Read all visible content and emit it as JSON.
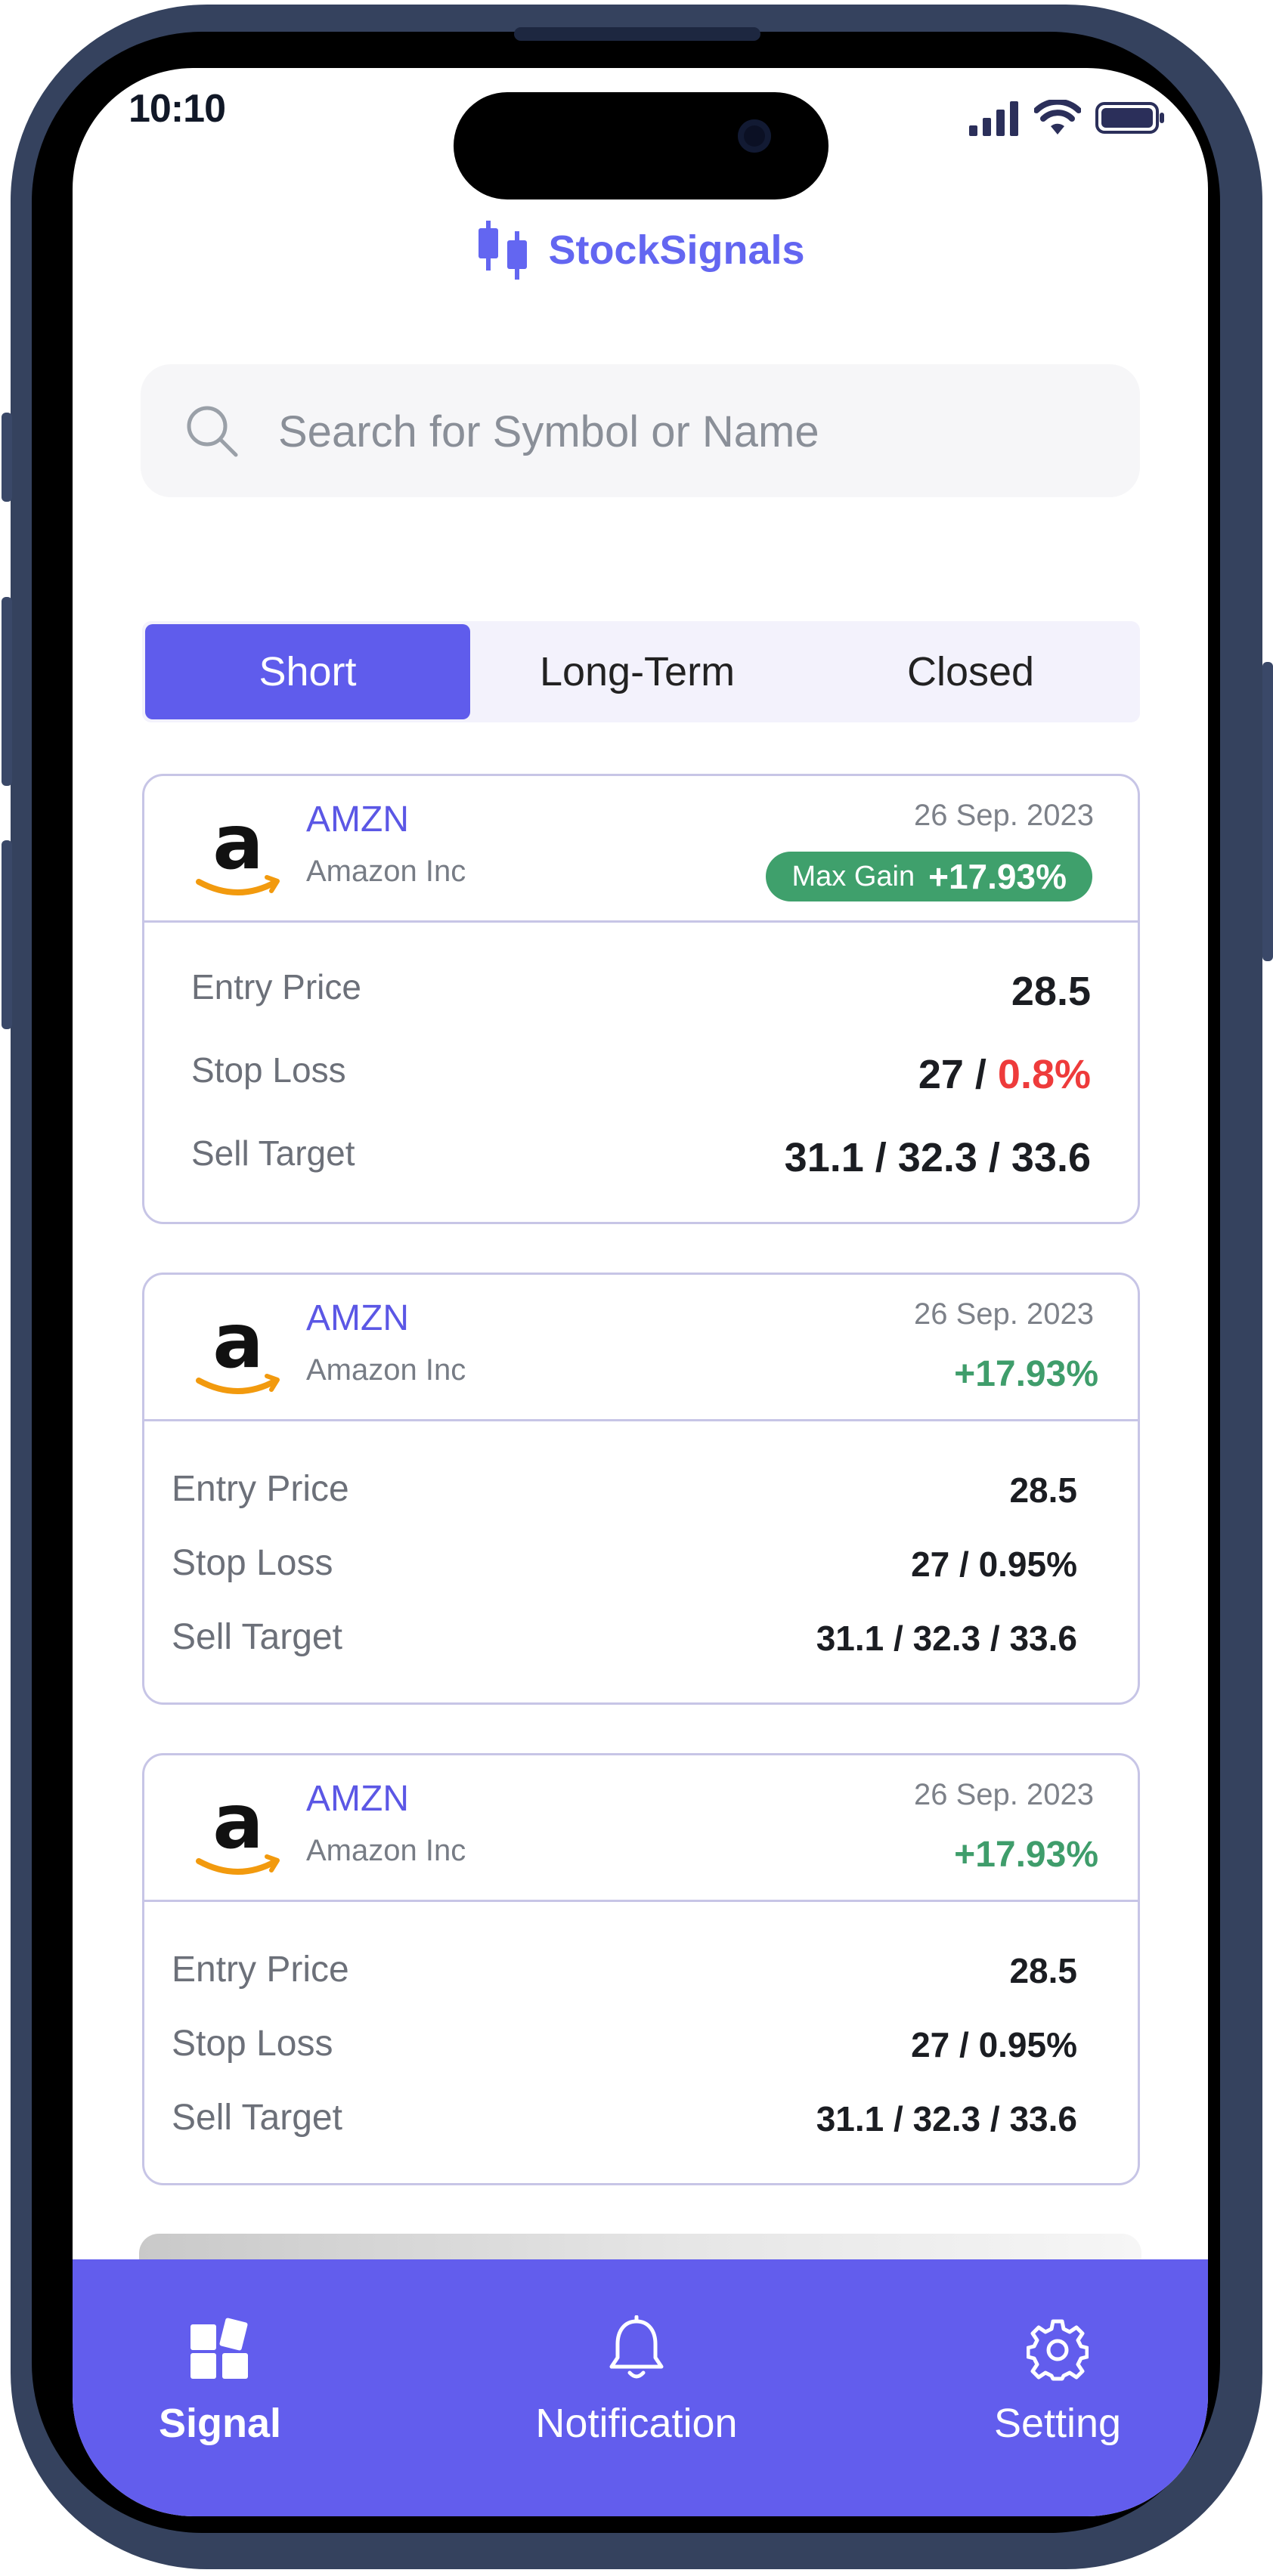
{
  "status_bar": {
    "time": "10:10"
  },
  "app": {
    "name": "StockSignals"
  },
  "search": {
    "placeholder": "Search for Symbol or Name"
  },
  "tabs": [
    {
      "label": "Short",
      "active": true
    },
    {
      "label": "Long-Term",
      "active": false
    },
    {
      "label": "Closed",
      "active": false
    }
  ],
  "cards": [
    {
      "symbol": "AMZN",
      "company": "Amazon Inc",
      "date": "26 Sep. 2023",
      "badge_label": "Max Gain",
      "gain": "+17.93%",
      "rows": {
        "entry_label": "Entry Price",
        "entry_value": "28.5",
        "stop_label": "Stop Loss",
        "stop_value": "27 / ",
        "stop_pct": "0.8%",
        "target_label": "Sell Target",
        "target_value": "31.1 / 32.3 / 33.6"
      }
    },
    {
      "symbol": "AMZN",
      "company": "Amazon Inc",
      "date": "26 Sep. 2023",
      "gain": "+17.93%",
      "rows": {
        "entry_label": "Entry Price",
        "entry_value": "28.5",
        "stop_label": "Stop Loss",
        "stop_value": "27 / 0.95%",
        "target_label": "Sell Target",
        "target_value": "31.1 / 32.3 / 33.6"
      }
    },
    {
      "symbol": "AMZN",
      "company": "Amazon Inc",
      "date": "26 Sep. 2023",
      "gain": "+17.93%",
      "rows": {
        "entry_label": "Entry Price",
        "entry_value": "28.5",
        "stop_label": "Stop Loss",
        "stop_value": "27 / 0.95%",
        "target_label": "Sell Target",
        "target_value": "31.1 / 32.3 / 33.6"
      }
    }
  ],
  "bottom_nav": [
    {
      "label": "Signal",
      "icon": "dashboard-icon",
      "active": true
    },
    {
      "label": "Notification",
      "icon": "bell-icon",
      "active": false
    },
    {
      "label": "Setting",
      "icon": "gear-icon",
      "active": false
    }
  ],
  "colors": {
    "accent": "#5f5cec",
    "gain_green": "#3fa06c",
    "loss_red": "#ee3b3b",
    "frame": "#35425e"
  }
}
